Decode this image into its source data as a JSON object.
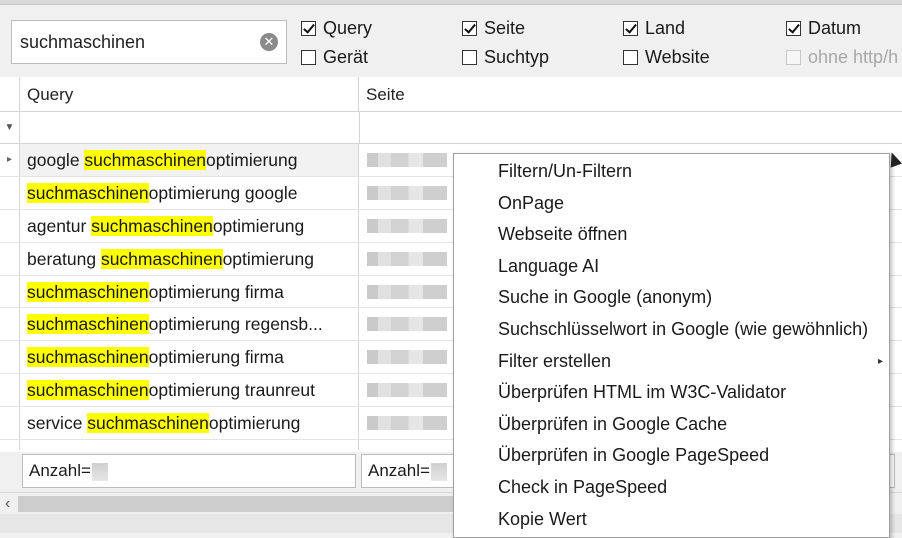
{
  "search": {
    "value": "suchmaschinen"
  },
  "checkboxes": [
    {
      "label": "Query",
      "checked": true,
      "disabled": false
    },
    {
      "label": "Seite",
      "checked": true,
      "disabled": false
    },
    {
      "label": "Land",
      "checked": true,
      "disabled": false
    },
    {
      "label": "Datum",
      "checked": true,
      "disabled": false
    },
    {
      "label": "Gerät",
      "checked": false,
      "disabled": false
    },
    {
      "label": "Suchtyp",
      "checked": false,
      "disabled": false
    },
    {
      "label": "Website",
      "checked": false,
      "disabled": false
    },
    {
      "label": "ohne http/h",
      "checked": false,
      "disabled": true
    }
  ],
  "grid": {
    "columns": [
      "Query",
      "Seite"
    ],
    "rows": [
      {
        "pre": "google ",
        "hl": "suchmaschinen",
        "post": "optimierung"
      },
      {
        "pre": "",
        "hl": "suchmaschinen",
        "post": "optimierung google"
      },
      {
        "pre": "agentur ",
        "hl": "suchmaschinen",
        "post": "optimierung"
      },
      {
        "pre": "beratung ",
        "hl": "suchmaschinen",
        "post": "optimierung"
      },
      {
        "pre": "",
        "hl": "suchmaschinen",
        "post": "optimierung firma"
      },
      {
        "pre": "",
        "hl": "suchmaschinen",
        "post": "optimierung regensb..."
      },
      {
        "pre": "",
        "hl": "suchmaschinen",
        "post": "optimierung firma"
      },
      {
        "pre": "",
        "hl": "suchmaschinen",
        "post": "optimierung traunreut"
      },
      {
        "pre": "service ",
        "hl": "suchmaschinen",
        "post": "optimierung"
      }
    ]
  },
  "footer": {
    "count_label_1": "Anzahl=",
    "count_label_2": "Anzahl="
  },
  "context_menu": {
    "items": [
      {
        "label": "Filtern/Un-Filtern"
      },
      {
        "label": "OnPage"
      },
      {
        "label": "Webseite öffnen"
      },
      {
        "label": "Language AI"
      },
      {
        "label": "Suche in Google (anonym)"
      },
      {
        "label": "Suchschlüsselwort in Google (wie gewöhnlich)"
      },
      {
        "label": "Filter erstellen",
        "submenu_arrow": "▸"
      },
      {
        "label": "Überprüfen HTML im W3C-Validator"
      },
      {
        "label": "Überprüfen in Google Cache"
      },
      {
        "label": "Überprüfen in Google PageSpeed"
      },
      {
        "label": "Check in PageSpeed"
      },
      {
        "label": "Kopie Wert"
      }
    ]
  }
}
